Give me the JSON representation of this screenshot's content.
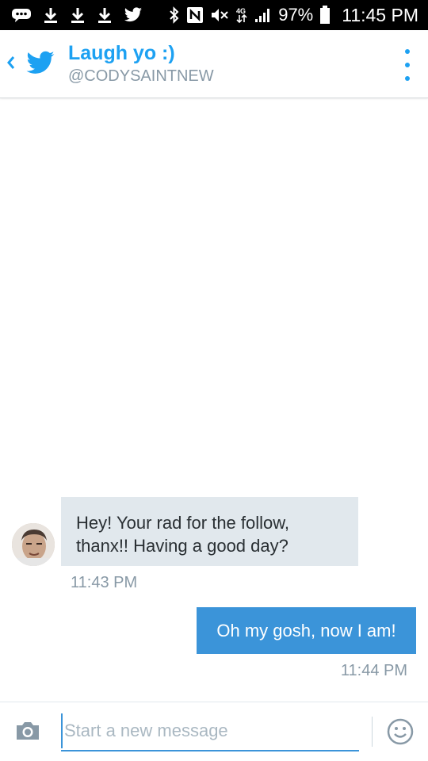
{
  "status_bar": {
    "battery_percent": "97%",
    "time": "11:45 PM",
    "icons": [
      "message-icon",
      "download-icon",
      "download-icon",
      "download-icon",
      "twitter-icon",
      "bluetooth-icon",
      "nfc-icon",
      "mute-icon",
      "data-icon",
      "signal-icon",
      "battery-icon"
    ]
  },
  "header": {
    "title": "Laugh yo :)",
    "handle": "@CODYSAINTNEW",
    "accent_color": "#1da1f2"
  },
  "messages": [
    {
      "direction": "incoming",
      "text": "Hey! Your rad for the follow, thanx!! Having a good day?",
      "time": "11:43 PM"
    },
    {
      "direction": "outgoing",
      "text": "Oh my gosh, now I am!",
      "time": "11:44 PM"
    }
  ],
  "composer": {
    "placeholder": "Start a new message",
    "value": ""
  },
  "colors": {
    "incoming_bubble": "#e1e8ed",
    "outgoing_bubble": "#3b94d9",
    "muted_text": "#8899a6"
  }
}
